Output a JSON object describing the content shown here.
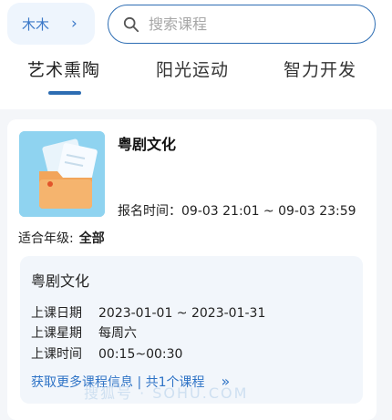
{
  "header": {
    "student_name": "木木",
    "search_placeholder": "搜索课程"
  },
  "tabs": [
    {
      "label": "艺术熏陶",
      "active": true
    },
    {
      "label": "阳光运动",
      "active": false
    },
    {
      "label": "智力开发",
      "active": false
    }
  ],
  "course": {
    "title": "粤剧文化",
    "enroll_label": "报名时间：",
    "enroll_time": "09-03 21:01 ~ 09-03 23:59",
    "grade_label": "适合年级:",
    "grade_value": "全部",
    "class": {
      "name": "粤剧文化",
      "date_label": "上课日期",
      "date_value": "2023-01-01 ~ 2023-01-31",
      "weekday_label": "上课星期",
      "weekday_value": "每周六",
      "time_label": "上课时间",
      "time_value": "00:15~00:30"
    },
    "more_text": "获取更多课程信息 | 共1个课程"
  },
  "watermark": "搜狐号 · SOHU.COM",
  "colors": {
    "accent": "#2d6db3",
    "link": "#2e73c6",
    "thumb_bg": "#8fd3f0",
    "folder": "#f2a55a"
  }
}
